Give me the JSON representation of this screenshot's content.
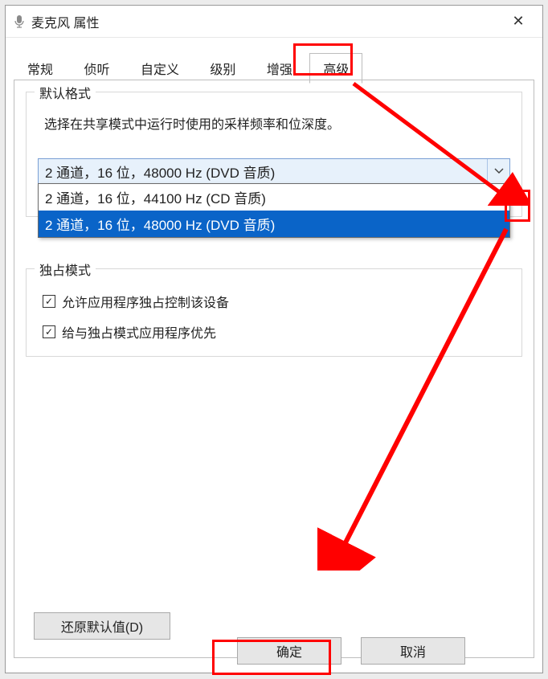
{
  "window": {
    "title": "麦克风 属性"
  },
  "tabs": {
    "items": [
      {
        "label": "常规"
      },
      {
        "label": "侦听"
      },
      {
        "label": "自定义"
      },
      {
        "label": "级别"
      },
      {
        "label": "增强"
      },
      {
        "label": "高级"
      }
    ],
    "active_index": 5
  },
  "default_format": {
    "group_title": "默认格式",
    "description": "选择在共享模式中运行时使用的采样频率和位深度。",
    "selected": "2 通道，16 位，48000 Hz (DVD 音质)",
    "options": [
      "2 通道，16 位，44100 Hz (CD 音质)",
      "2 通道，16 位，48000 Hz (DVD 音质)"
    ],
    "selected_option_index": 1
  },
  "exclusive_mode": {
    "group_title": "独占模式",
    "checkboxes": [
      {
        "label": "允许应用程序独占控制该设备",
        "checked": true
      },
      {
        "label": "给与独占模式应用程序优先",
        "checked": true
      }
    ]
  },
  "buttons": {
    "restore_defaults": "还原默认值(D)",
    "ok": "确定",
    "cancel": "取消"
  },
  "icons": {
    "checkmark": "✓"
  }
}
